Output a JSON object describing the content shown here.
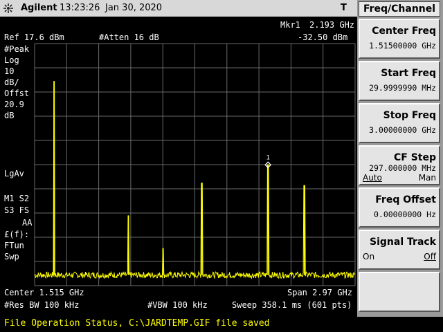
{
  "header": {
    "logo_text": "Agilent",
    "time": "13:23:26",
    "date": "Jan 30, 2020",
    "indicator": "T"
  },
  "marker": {
    "label": "Mkr1",
    "freq": "2.193 GHz",
    "amp": "-32.50 dBm",
    "number": "1"
  },
  "settings": {
    "ref": "Ref 17.6 dBm",
    "atten": "#Atten 16 dB"
  },
  "left_panel": {
    "lines1": [
      "#Peak",
      "Log",
      "10",
      "dB/",
      "Offst",
      "20.9",
      "dB"
    ],
    "lgav": "LgAv",
    "m_row1": "M1  S2",
    "m_row2": "S3  FS",
    "aa": "AA",
    "lines2": [
      "£(f):",
      "FTun",
      "Swp"
    ]
  },
  "footer": {
    "center": "Center 1.515 GHz",
    "span": "Span 2.97 GHz",
    "res_bw": "#Res BW 100 kHz",
    "vbw": "#VBW 100 kHz",
    "sweep": "Sweep 358.1 ms (601 pts)"
  },
  "status_bar": {
    "text": "File Operation Status, C:\\JARDTEMP.GIF file saved"
  },
  "softkeys": {
    "menu_title": "Freq/Channel",
    "center_freq": {
      "label": "Center Freq",
      "value": "1.51500000 GHz"
    },
    "start_freq": {
      "label": "Start Freq",
      "value": "29.9999990 MHz"
    },
    "stop_freq": {
      "label": "Stop Freq",
      "value": "3.00000000 GHz"
    },
    "cf_step": {
      "label": "CF Step",
      "value": "297.000000 MHz",
      "opt_auto": "Auto",
      "opt_man": "Man"
    },
    "freq_offset": {
      "label": "Freq Offset",
      "value": "0.00000000  Hz"
    },
    "signal_track": {
      "label": "Signal Track",
      "opt_on": "On",
      "opt_off": "Off"
    }
  },
  "colors": {
    "trace": "#ffff00",
    "graticule": "#6a6a6a",
    "background": "#000000",
    "softkey_panel": "#9a9a9a"
  },
  "chart_data": {
    "type": "line",
    "x_unit": "GHz",
    "y_unit": "dBm",
    "xlim": [
      0.03,
      3.0
    ],
    "ylim": [
      -82.4,
      17.6
    ],
    "noise_floor": -78,
    "peaks": [
      {
        "x": 0.21,
        "y": 2.0
      },
      {
        "x": 0.9,
        "y": -53.5
      },
      {
        "x": 1.22,
        "y": -67.0
      },
      {
        "x": 1.58,
        "y": -40.0
      },
      {
        "x": 2.193,
        "y": -32.5
      },
      {
        "x": 2.53,
        "y": -41.0
      }
    ]
  }
}
